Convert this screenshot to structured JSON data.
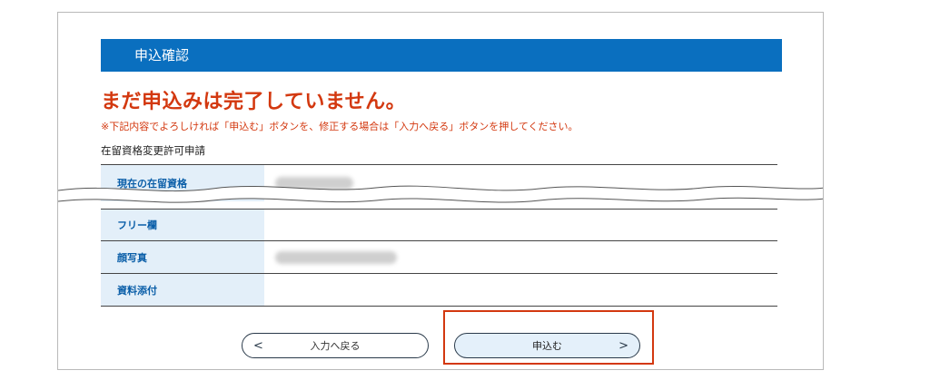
{
  "header": {
    "title": "申込確認"
  },
  "notice": {
    "title": "まだ申込みは完了していません。",
    "note": "※下記内容でよろしければ「申込む」ボタンを、修正する場合は「入力へ戻る」ボタンを押してください。"
  },
  "application": {
    "type": "在留資格変更許可申請"
  },
  "table_top": {
    "rows": [
      {
        "label": "現在の在留資格"
      }
    ]
  },
  "table_bottom": {
    "rows": [
      {
        "label": "フリー欄"
      },
      {
        "label": "顔写真"
      },
      {
        "label": "資料添付"
      }
    ]
  },
  "buttons": {
    "back_label": "入力へ戻る",
    "back_chevron": "<",
    "submit_label": "申込む",
    "submit_chevron": ">"
  },
  "colors": {
    "header": "#0a6fbf",
    "warning": "#d3380f",
    "label_bg": "#e3eff9",
    "highlight": "#d3380f"
  }
}
